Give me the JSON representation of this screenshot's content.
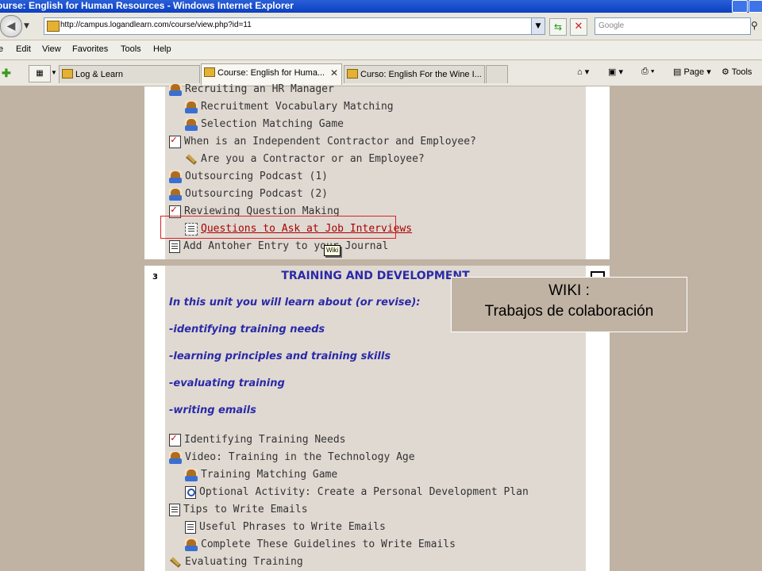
{
  "window": {
    "title": "ourse: English for Human Resources - Windows Internet Explorer"
  },
  "address_bar": {
    "url": "http://campus.logandlearn.com/course/view.php?id=11"
  },
  "search": {
    "placeholder": "Google"
  },
  "menu": [
    "e",
    "Edit",
    "View",
    "Favorites",
    "Tools",
    "Help"
  ],
  "tabs": [
    {
      "label": "Log & Learn",
      "active": false
    },
    {
      "label": "Course: English for Huma...",
      "active": true
    },
    {
      "label": "Curso: English For the Wine I...",
      "active": false
    }
  ],
  "toolbar": {
    "page_label": "Page",
    "tools_label": "Tools"
  },
  "section_top": {
    "items": [
      {
        "label": "Recruiting an HR Manager",
        "icon": "hand-icon",
        "indent": false
      },
      {
        "label": "Recruitment Vocabulary Matching",
        "icon": "hand-icon",
        "indent": true
      },
      {
        "label": "Selection Matching Game",
        "icon": "hand-icon",
        "indent": true
      },
      {
        "label": "When is an Independent Contractor and Employee?",
        "icon": "quiz-icon",
        "indent": false
      },
      {
        "label": "Are you a Contractor or an Employee?",
        "icon": "pencil-icon",
        "indent": true
      },
      {
        "label": "Outsourcing Podcast (1)",
        "icon": "hand-icon",
        "indent": false
      },
      {
        "label": "Outsourcing Podcast (2)",
        "icon": "hand-icon",
        "indent": false
      },
      {
        "label": "Reviewing Question Making",
        "icon": "quiz-icon",
        "indent": false
      },
      {
        "label": "Questions to Ask at Job Interviews",
        "icon": "wiki-icon",
        "indent": true
      },
      {
        "label": "Add Antoher Entry to your Journal",
        "icon": "doc-icon",
        "indent": false
      }
    ],
    "tooltip": "Wiki"
  },
  "section_3": {
    "number": "3",
    "title": "TRAINING AND DEVELOPMENT",
    "intro_lines": [
      "In this unit you will learn about (or revise):",
      "-identifying training needs",
      "-learning principles and training skills",
      "-evaluating training",
      "-writing emails"
    ],
    "items": [
      {
        "label": "Identifying Training Needs",
        "icon": "quiz-icon",
        "indent": false
      },
      {
        "label": "Video: Training in the Technology Age",
        "icon": "hand-icon",
        "indent": false
      },
      {
        "label": "Training Matching Game",
        "icon": "hand-icon",
        "indent": true
      },
      {
        "label": "Optional Activity: Create a Personal Development Plan",
        "icon": "magnifier-icon",
        "indent": true
      },
      {
        "label": "Tips to Write Emails",
        "icon": "doc-icon",
        "indent": false
      },
      {
        "label": "Useful Phrases to Write Emails",
        "icon": "doc-icon",
        "indent": true
      },
      {
        "label": "Complete These Guidelines to Write Emails",
        "icon": "hand-icon",
        "indent": true
      },
      {
        "label": "Evaluating Training",
        "icon": "pencil-icon",
        "indent": false
      }
    ]
  },
  "callout": {
    "line1": "WIKI :",
    "line2": "Trabajos de colaboración"
  }
}
